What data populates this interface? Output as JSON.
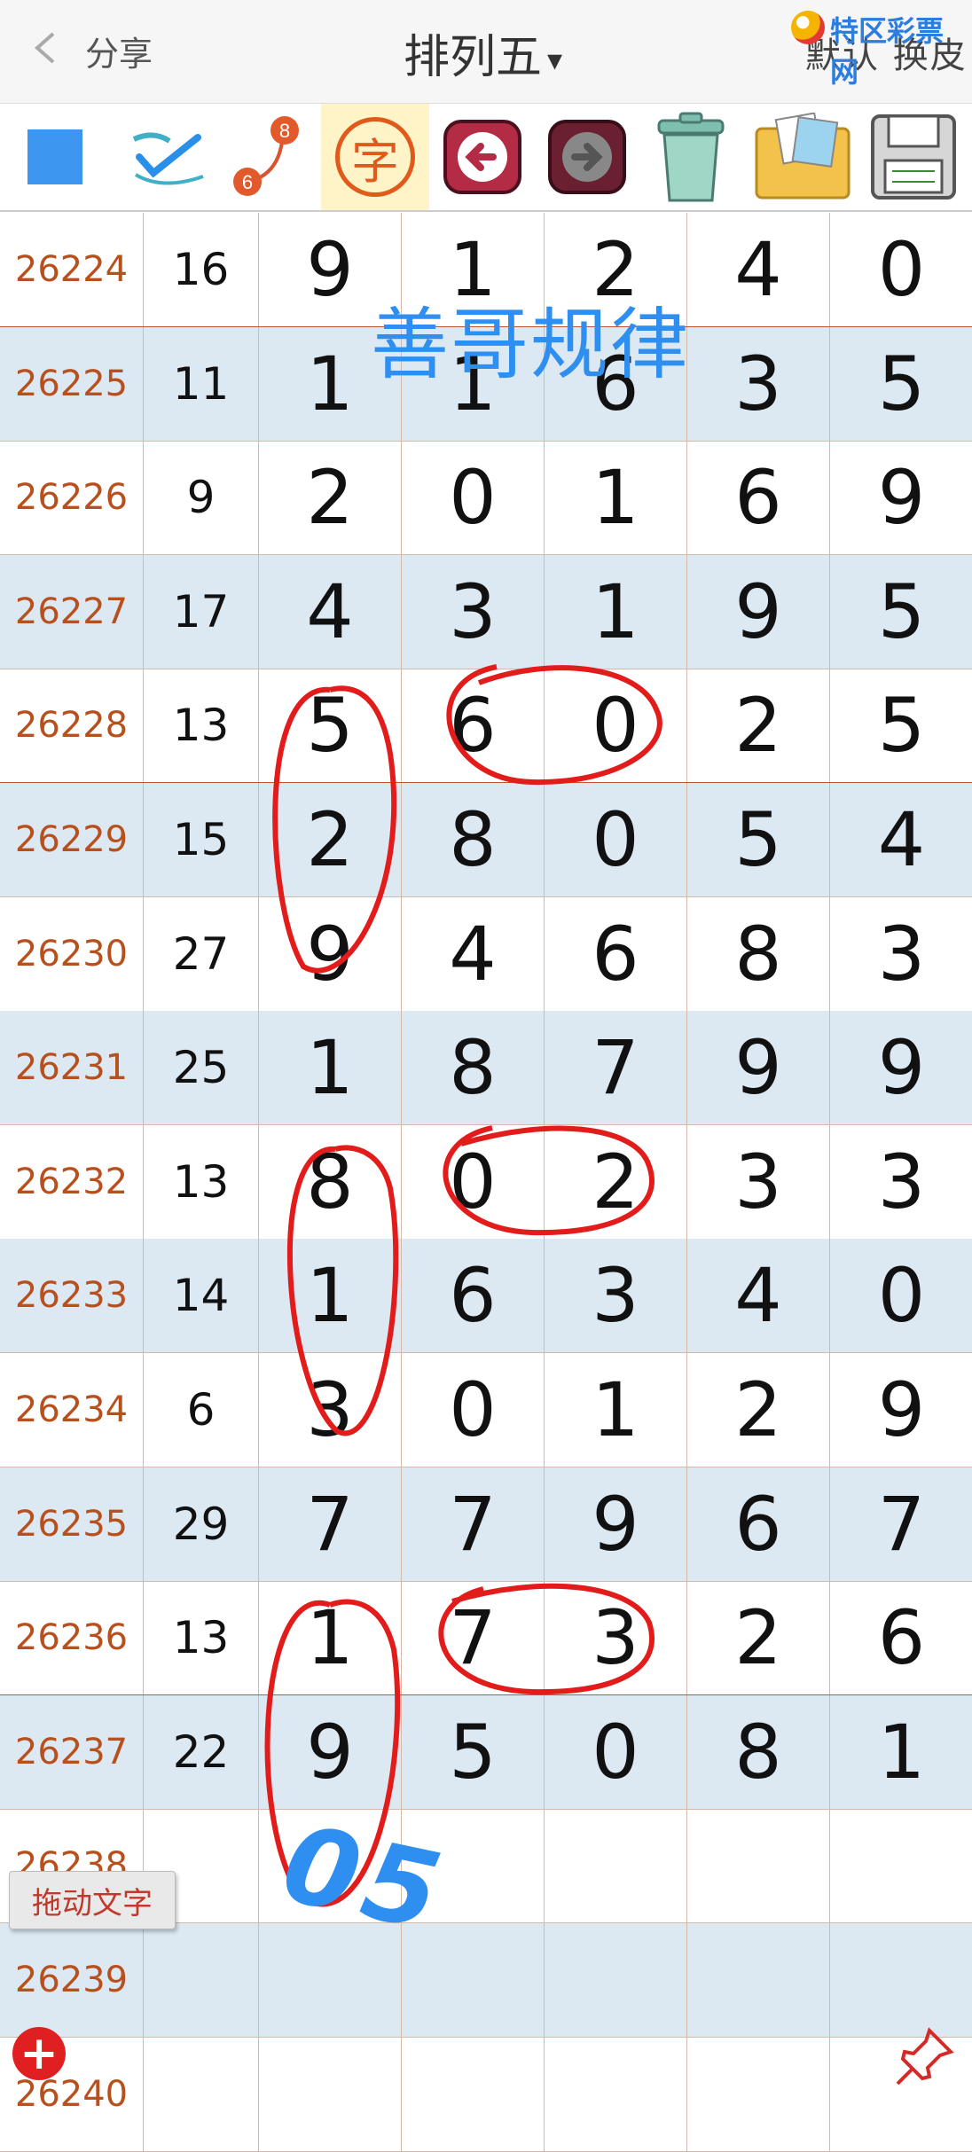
{
  "header": {
    "back_label": "分享",
    "title": "排列五",
    "title_caret": "▾",
    "right_label": "默认 换皮",
    "logo_text": "特区彩票网"
  },
  "toolbar": {
    "tools": [
      "color-square-icon",
      "pen-check-icon",
      "number-link-icon",
      "text-char-icon",
      "back-arrow-icon",
      "forward-arrow-icon",
      "trash-icon",
      "image-folder-icon",
      "save-disk-icon"
    ],
    "text_char": "字",
    "link_top": "8",
    "link_bottom": "6"
  },
  "colors": {
    "id_text": "#b8501e",
    "row_shade": "#dce9f3",
    "divider": "#c0552e",
    "annotation_red": "#e21b1b",
    "annotation_blue": "#2f8ff0"
  },
  "table": {
    "rows": [
      {
        "id": "26224",
        "sum": "16",
        "d": [
          "9",
          "1",
          "2",
          "4",
          "0"
        ]
      },
      {
        "id": "26225",
        "sum": "11",
        "d": [
          "1",
          "1",
          "6",
          "3",
          "5"
        ]
      },
      {
        "id": "26226",
        "sum": "9",
        "d": [
          "2",
          "0",
          "1",
          "6",
          "9"
        ]
      },
      {
        "id": "26227",
        "sum": "17",
        "d": [
          "4",
          "3",
          "1",
          "9",
          "5"
        ]
      },
      {
        "id": "26228",
        "sum": "13",
        "d": [
          "5",
          "6",
          "0",
          "2",
          "5"
        ]
      },
      {
        "id": "26229",
        "sum": "15",
        "d": [
          "2",
          "8",
          "0",
          "5",
          "4"
        ]
      },
      {
        "id": "26230",
        "sum": "27",
        "d": [
          "9",
          "4",
          "6",
          "8",
          "3"
        ]
      },
      {
        "id": "26231",
        "sum": "25",
        "d": [
          "1",
          "8",
          "7",
          "9",
          "9"
        ]
      },
      {
        "id": "26232",
        "sum": "13",
        "d": [
          "8",
          "0",
          "2",
          "3",
          "3"
        ]
      },
      {
        "id": "26233",
        "sum": "14",
        "d": [
          "1",
          "6",
          "3",
          "4",
          "0"
        ]
      },
      {
        "id": "26234",
        "sum": "6",
        "d": [
          "3",
          "0",
          "1",
          "2",
          "9"
        ]
      },
      {
        "id": "26235",
        "sum": "29",
        "d": [
          "7",
          "7",
          "9",
          "6",
          "7"
        ]
      },
      {
        "id": "26236",
        "sum": "13",
        "d": [
          "1",
          "7",
          "3",
          "2",
          "6"
        ]
      },
      {
        "id": "26237",
        "sum": "22",
        "d": [
          "9",
          "5",
          "0",
          "8",
          "1"
        ]
      },
      {
        "id": "26238",
        "sum": "",
        "d": [
          "",
          "",
          "",
          "",
          ""
        ]
      },
      {
        "id": "26239",
        "sum": "",
        "d": [
          "",
          "",
          "",
          "",
          ""
        ]
      },
      {
        "id": "26240",
        "sum": "",
        "d": [
          "",
          "",
          "",
          "",
          ""
        ]
      }
    ]
  },
  "annotations": {
    "watermark": "善哥规律",
    "handwritten": "05"
  },
  "drag_text_button": "拖动文字",
  "add_button": "+"
}
